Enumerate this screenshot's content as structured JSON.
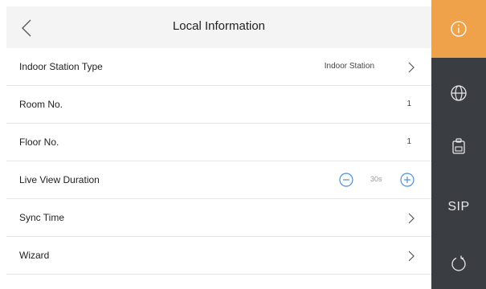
{
  "header": {
    "title": "Local Information"
  },
  "settings": {
    "indoor_station_type": {
      "label": "Indoor Station Type",
      "value": "Indoor Station"
    },
    "room_no": {
      "label": "Room No.",
      "value": "1"
    },
    "floor_no": {
      "label": "Floor No.",
      "value": "1"
    },
    "live_view_duration": {
      "label": "Live View Duration",
      "value": "30s"
    },
    "sync_time": {
      "label": "Sync Time"
    },
    "wizard": {
      "label": "Wizard"
    }
  },
  "sidebar": {
    "items": [
      {
        "icon": "info-icon",
        "active": true
      },
      {
        "icon": "globe-icon",
        "active": false
      },
      {
        "icon": "clipboard-icon",
        "active": false
      },
      {
        "label": "SIP",
        "active": false
      },
      {
        "icon": "restart-icon",
        "active": false
      }
    ]
  },
  "colors": {
    "accent": "#efa24a",
    "sidebar_bg": "#3a3d42",
    "stepper_blue": "#4a8fe0"
  }
}
